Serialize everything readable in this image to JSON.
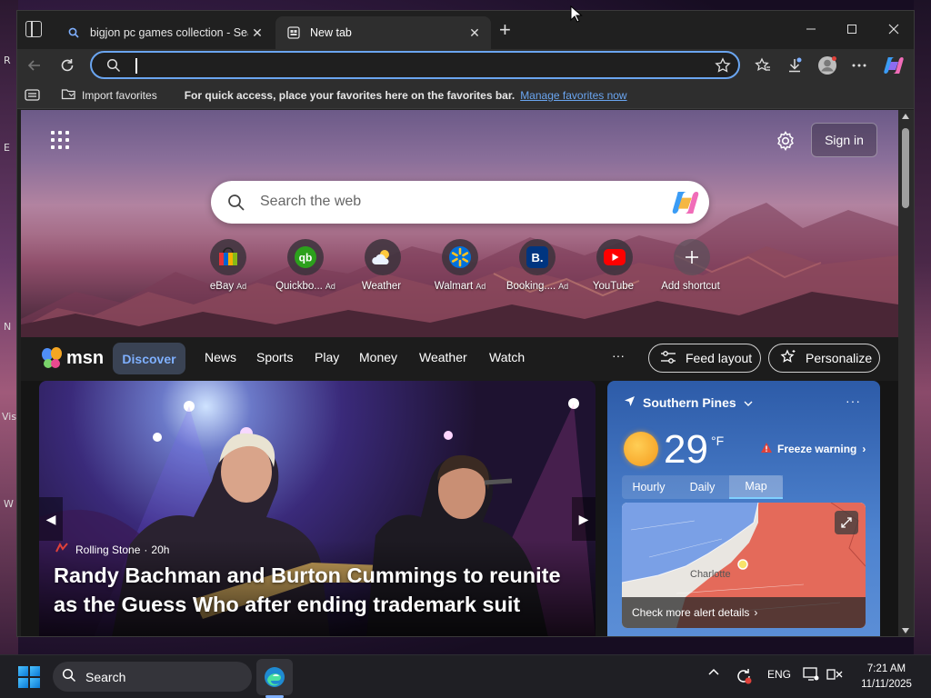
{
  "desktop": {
    "fragments": [
      "R",
      "E",
      "N",
      "Vis",
      "W"
    ]
  },
  "tabs": [
    {
      "title": "bigjon pc games collection - Sear",
      "icon": "search-icon"
    },
    {
      "title": "New tab",
      "icon": "newtab-page-icon"
    }
  ],
  "toolbar": {
    "address_value": ""
  },
  "favorites_bar": {
    "import_label": "Import favorites",
    "hint": "For quick access, place your favorites here on the favorites bar.",
    "manage_link": "Manage favorites now"
  },
  "ntp": {
    "sign_in": "Sign in",
    "search_placeholder": "Search the web",
    "shortcuts": [
      {
        "label": "eBay",
        "ad": "Ad",
        "icon": "ebay-bag-icon"
      },
      {
        "label": "Quickbo...",
        "ad": "Ad",
        "icon": "quickbooks-icon"
      },
      {
        "label": "Weather",
        "ad": "",
        "icon": "weather-cloud-icon"
      },
      {
        "label": "Walmart",
        "ad": "Ad",
        "icon": "walmart-spark-icon"
      },
      {
        "label": "Booking....",
        "ad": "Ad",
        "icon": "booking-icon"
      },
      {
        "label": "YouTube",
        "ad": "",
        "icon": "youtube-icon"
      },
      {
        "label": "Add shortcut",
        "ad": "",
        "icon": "plus-icon"
      }
    ]
  },
  "msn": {
    "logo_text": "msn",
    "nav": [
      "Discover",
      "News",
      "Sports",
      "Play",
      "Money",
      "Weather",
      "Watch"
    ],
    "more": "···",
    "feed_layout": "Feed layout",
    "personalize": "Personalize"
  },
  "story": {
    "source": "Rolling Stone",
    "age": "20h",
    "title": "Randy Bachman and Burton Cummings to reunite as the Guess Who after ending trademark suit"
  },
  "weather": {
    "location": "Southern Pines",
    "temp": "29",
    "unit": "°F",
    "alert": "Freeze warning",
    "tabs": [
      "Hourly",
      "Daily",
      "Map"
    ],
    "active_tab": "Map",
    "map_city": "Charlotte",
    "map_alert": "Check more alert details"
  },
  "taskbar": {
    "search_label": "Search",
    "lang": "ENG",
    "time": "7:21 AM",
    "date": "11/11/2025"
  },
  "colors": {
    "accent": "#6aa5f0",
    "discover": "#7fb0ff",
    "warning": "#e0413a"
  }
}
